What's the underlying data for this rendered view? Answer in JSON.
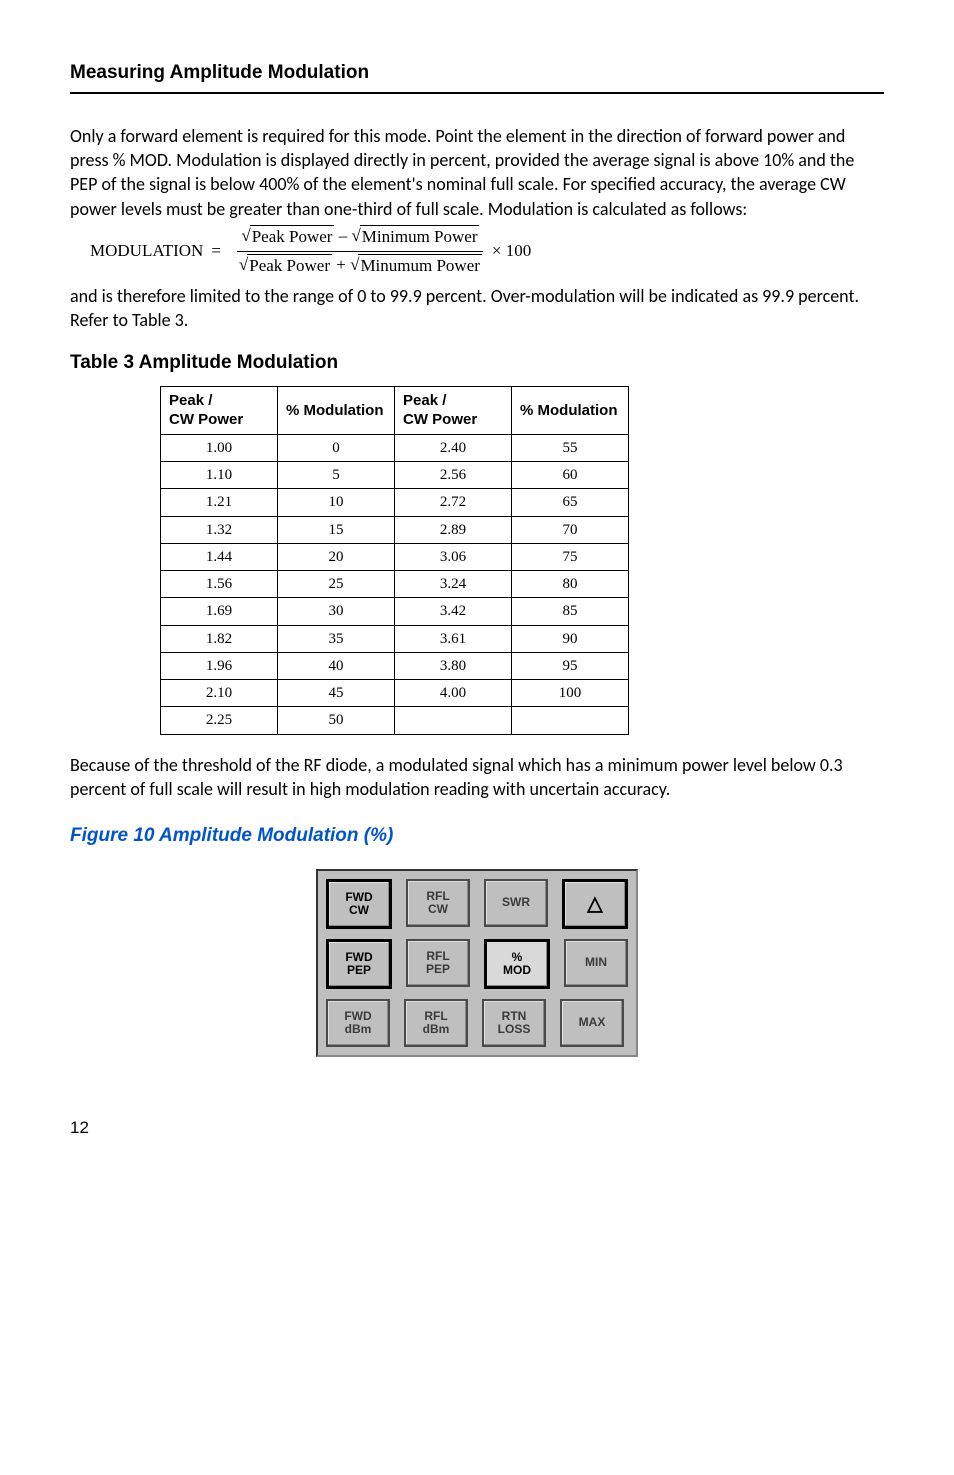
{
  "section_title": "Measuring Amplitude Modulation",
  "para1": "Only a forward element is required for this mode. Point the element in the direction of forward power and press % MOD. Modulation is displayed directly in percent, provided the average signal is above 10% and the PEP of the signal is below 400% of the element's nominal full scale. For specified accuracy, the average CW power levels must be greater than one-third of full scale. Modulation is calculated as follows:",
  "formula": {
    "lhs": "MODULATION",
    "num_a": "Peak Power",
    "num_b": "Minimum Power",
    "den_a": "Peak Power",
    "den_b": "Minumum Power",
    "tail": "× 100"
  },
  "para2": "and is therefore limited to the range of 0 to 99.9 percent. Over-modulation will be indicated as 99.9 percent. Refer to Table 3.",
  "table_label": "Table 3   Amplitude Modulation",
  "table": {
    "headers": [
      "Peak /\nCW Power",
      "% Modulation",
      "Peak /\nCW Power",
      "% Modulation"
    ],
    "rows": [
      [
        "1.00",
        "0",
        "2.40",
        "55"
      ],
      [
        "1.10",
        "5",
        "2.56",
        "60"
      ],
      [
        "1.21",
        "10",
        "2.72",
        "65"
      ],
      [
        "1.32",
        "15",
        "2.89",
        "70"
      ],
      [
        "1.44",
        "20",
        "3.06",
        "75"
      ],
      [
        "1.56",
        "25",
        "3.24",
        "80"
      ],
      [
        "1.69",
        "30",
        "3.42",
        "85"
      ],
      [
        "1.82",
        "35",
        "3.61",
        "90"
      ],
      [
        "1.96",
        "40",
        "3.80",
        "95"
      ],
      [
        "2.10",
        "45",
        "4.00",
        "100"
      ],
      [
        "2.25",
        "50",
        "",
        ""
      ]
    ]
  },
  "para3": "Because of the threshold of the RF diode, a modulated signal which has a minimum power level below 0.3 percent of full scale will result in high modulation reading with uncertain accuracy.",
  "figure_label": "Figure 10    Amplitude Modulation (%)",
  "keypad": {
    "rows": [
      [
        {
          "label": "FWD\nCW",
          "name": "fwd-cw-button",
          "outlined": true
        },
        {
          "label": "RFL\nCW",
          "name": "rfl-cw-button",
          "outlined": false
        },
        {
          "label": "SWR",
          "name": "swr-button",
          "outlined": false
        },
        {
          "label": "△",
          "name": "triangle-button",
          "outlined": true,
          "big": true
        }
      ],
      [
        {
          "label": "FWD\nPEP",
          "name": "fwd-pep-button",
          "outlined": true
        },
        {
          "label": "RFL\nPEP",
          "name": "rfl-pep-button",
          "outlined": false
        },
        {
          "label": "%\nMOD",
          "name": "pct-mod-button",
          "outlined": false,
          "active": true
        },
        {
          "label": "MIN",
          "name": "min-button",
          "outlined": false
        }
      ],
      [
        {
          "label": "FWD\ndBm",
          "name": "fwd-dbm-button",
          "outlined": false
        },
        {
          "label": "RFL\ndBm",
          "name": "rfl-dbm-button",
          "outlined": false
        },
        {
          "label": "RTN\nLOSS",
          "name": "rtn-loss-button",
          "outlined": false
        },
        {
          "label": "MAX",
          "name": "max-button",
          "outlined": false
        }
      ]
    ]
  },
  "page_number": "12"
}
